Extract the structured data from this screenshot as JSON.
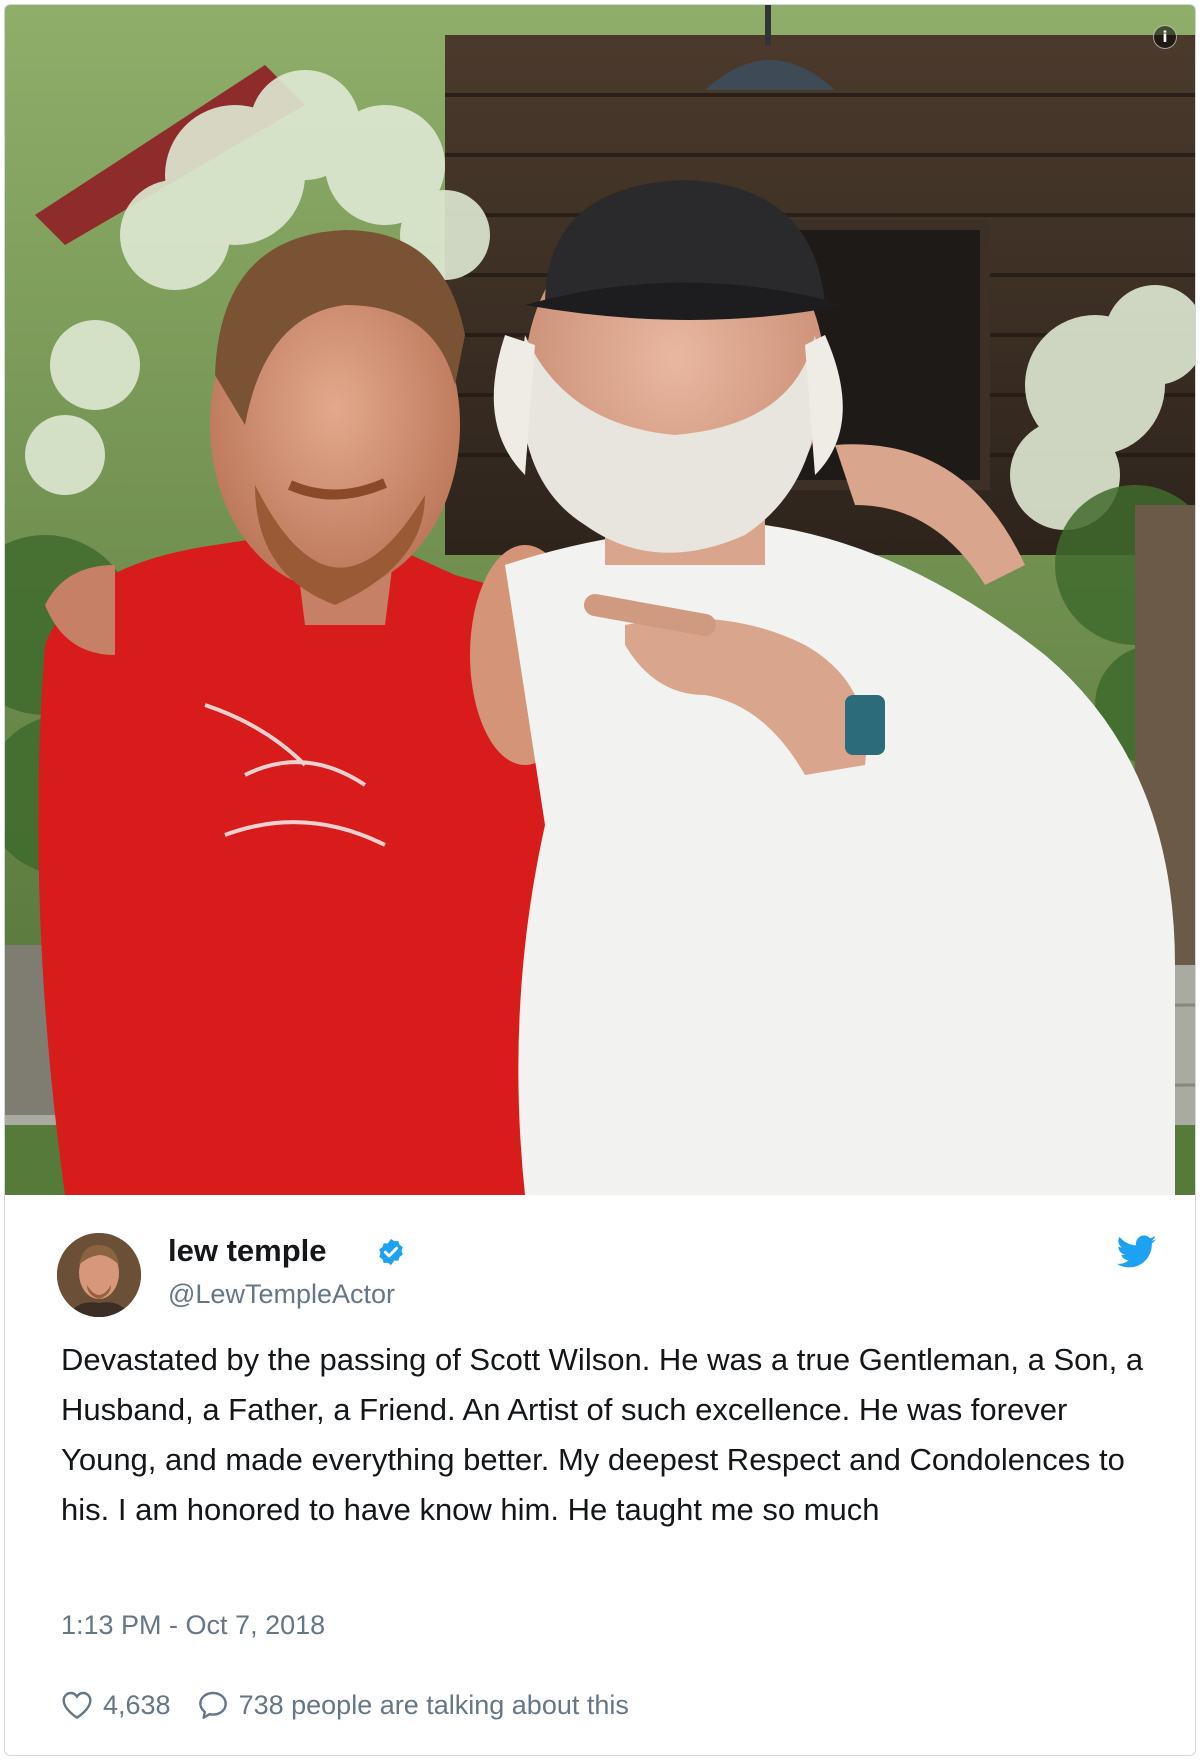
{
  "photo": {
    "alt_icon": "i",
    "info_icon": "info-icon"
  },
  "author": {
    "name": "lew temple",
    "handle": "@LewTempleActor",
    "verified_icon": "verified-badge-icon",
    "avatar_icon": "avatar"
  },
  "tweet": {
    "text": "Devastated by the passing of Scott Wilson. He was a true Gentleman, a Son, a Husband, a Father, a Friend. An Artist of such excellence. He was forever Young, and made everything better. My deepest Respect and Condolences to his. I am honored to have know him. He taught me so much",
    "timestamp": "1:13 PM - Oct 7, 2018"
  },
  "actions": {
    "likes": "4,638",
    "replies_text": "738 people are talking about this",
    "like_icon": "heart-icon",
    "reply_icon": "speech-bubble-icon"
  },
  "colors": {
    "verified": "#1da1f2",
    "twitter_blue": "#1da1f2",
    "muted": "#657786",
    "shirt": "#d81c1c"
  },
  "brand_icon": "twitter-bird-icon"
}
